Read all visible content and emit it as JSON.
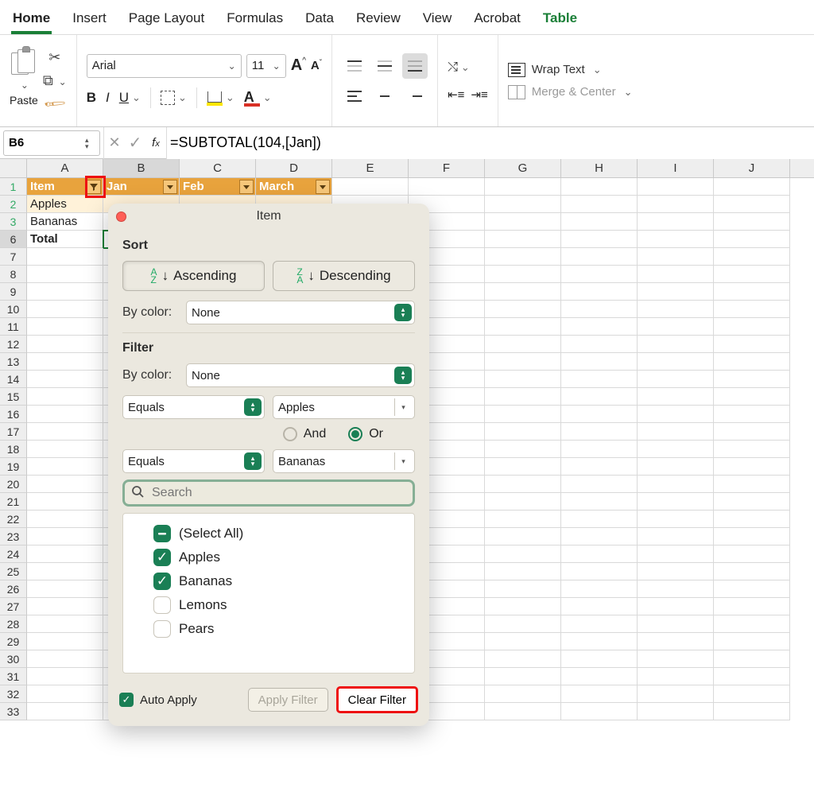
{
  "ribbon": {
    "tabs": [
      "Home",
      "Insert",
      "Page Layout",
      "Formulas",
      "Data",
      "Review",
      "View",
      "Acrobat",
      "Table"
    ],
    "active": "Home",
    "context_tab": "Table",
    "paste_label": "Paste",
    "font_name": "Arial",
    "font_size": "11",
    "bold": "B",
    "italic": "I",
    "underline": "U",
    "fill_color": "#ffe600",
    "font_color": "#d93025",
    "wrap_text": "Wrap Text",
    "merge_center": "Merge & Center"
  },
  "name_box": "B6",
  "formula": "=SUBTOTAL(104,[Jan])",
  "columns": [
    "A",
    "B",
    "C",
    "D",
    "E",
    "F",
    "G",
    "H",
    "I",
    "J"
  ],
  "row_numbers": [
    "1",
    "2",
    "3",
    "6",
    "7",
    "8",
    "9",
    "10",
    "11",
    "12",
    "13",
    "14",
    "15",
    "16",
    "17",
    "18",
    "19",
    "20",
    "21",
    "22",
    "23",
    "24",
    "25",
    "26",
    "27",
    "28",
    "29",
    "30",
    "31",
    "32",
    "33"
  ],
  "table": {
    "headers": [
      "Item",
      "Jan",
      "Feb",
      "March"
    ],
    "rows": [
      {
        "item": "Apples"
      },
      {
        "item": "Bananas"
      }
    ],
    "total_label": "Total"
  },
  "popover": {
    "title": "Item",
    "sort_label": "Sort",
    "ascending": "Ascending",
    "descending": "Descending",
    "by_color": "By color:",
    "none": "None",
    "filter_label": "Filter",
    "equals": "Equals",
    "cond1_value": "Apples",
    "cond2_value": "Bananas",
    "and": "And",
    "or": "Or",
    "or_checked": true,
    "search_placeholder": "Search",
    "items": [
      {
        "label": "(Select All)",
        "state": "indeterminate"
      },
      {
        "label": "Apples",
        "state": "checked"
      },
      {
        "label": "Bananas",
        "state": "checked"
      },
      {
        "label": "Lemons",
        "state": "unchecked"
      },
      {
        "label": "Pears",
        "state": "unchecked"
      }
    ],
    "auto_apply": "Auto Apply",
    "apply_filter": "Apply Filter",
    "clear_filter": "Clear Filter"
  }
}
